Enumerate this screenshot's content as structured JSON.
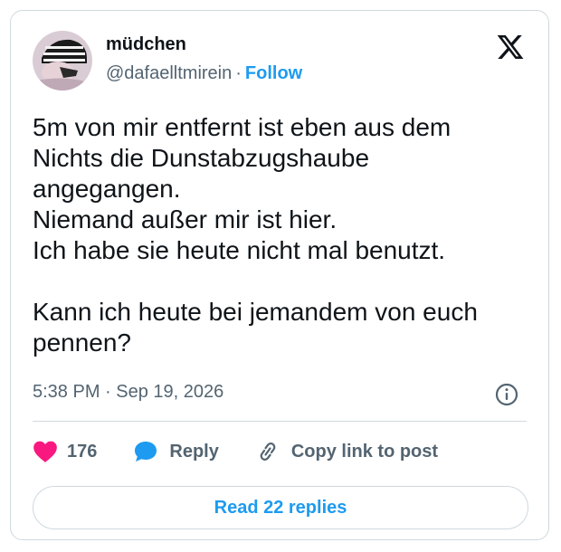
{
  "author": {
    "name": "müdchen",
    "handle": "@dafaelltmirein",
    "separator": "·",
    "follow_label": "Follow"
  },
  "icons": {
    "logo": "x-logo-icon",
    "info": "info-icon",
    "like": "heart-icon",
    "reply": "speech-bubble-icon",
    "copy": "link-icon"
  },
  "tweet": {
    "text": "5m von mir entfernt ist eben aus dem\nNichts die Dunstabzugshaube\nangegangen.\nNiemand außer mir ist hier.\nIch habe sie heute nicht mal benutzt.\n\nKann ich heute bei jemandem von euch\npennen?",
    "timestamp": "5:38 PM · Sep 19, 2026"
  },
  "actions": {
    "like_count": "176",
    "reply_label": "Reply",
    "copy_label": "Copy link to post"
  },
  "read_replies_label": "Read 22 replies",
  "colors": {
    "accent": "#1d9bf0",
    "like": "#f91880",
    "text": "#0f1419",
    "muted": "#536471",
    "border": "#cfd9de"
  }
}
